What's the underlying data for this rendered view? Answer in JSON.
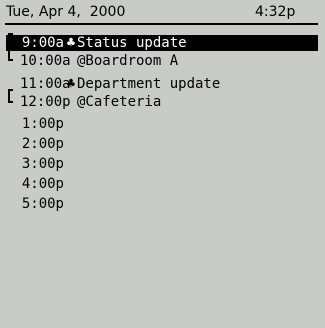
{
  "header": {
    "date": "Tue, Apr 4,  2000",
    "time": "4:32p"
  },
  "appointments": [
    {
      "time": "9:00a",
      "alarm": "♣",
      "text": "Status update",
      "selected": true
    },
    {
      "time": "10:00a",
      "alarm": "",
      "text": "@Boardroom A",
      "selected": false
    },
    {
      "time": "11:00a",
      "alarm": "♣",
      "text": "Department update",
      "selected": false
    },
    {
      "time": "12:00p",
      "alarm": "",
      "text": "@Cafeteria",
      "selected": false
    },
    {
      "time": "1:00p",
      "alarm": "",
      "text": "",
      "selected": false
    },
    {
      "time": "2:00p",
      "alarm": "",
      "text": "",
      "selected": false
    },
    {
      "time": "3:00p",
      "alarm": "",
      "text": "",
      "selected": false
    },
    {
      "time": "4:00p",
      "alarm": "",
      "text": "",
      "selected": false
    },
    {
      "time": "5:00p",
      "alarm": "",
      "text": "",
      "selected": false
    }
  ]
}
